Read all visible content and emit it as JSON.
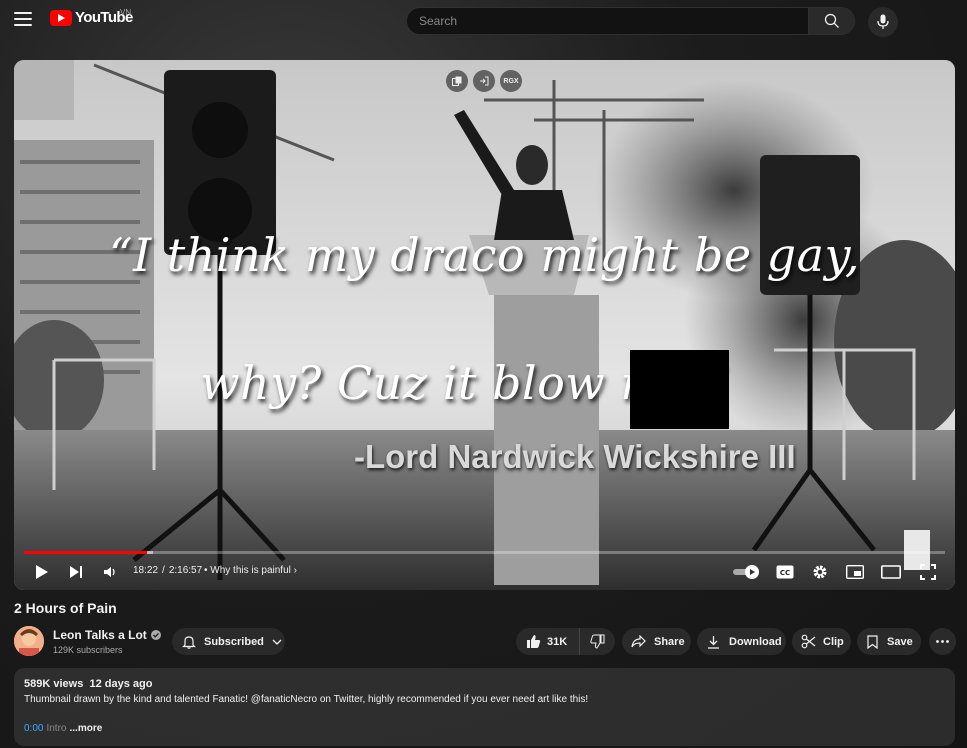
{
  "header": {
    "logo_text": "YouTube",
    "country_code": "VN",
    "search_placeholder": "Search"
  },
  "player": {
    "extension_badge": "RGX",
    "quote_line1": "“I think my draco might be gay,",
    "quote_line2": "why? Cuz it blow n     s.”",
    "attribution": "-Lord Nardwick Wickshire III",
    "current_time": "18:22",
    "time_separator": "/",
    "duration": "2:16:57",
    "chapter": "• Why this is painful",
    "progress_fraction": 0.134,
    "loaded_fraction": 0.14,
    "colors": {
      "progress_played": "#ff0000"
    }
  },
  "video": {
    "title": "2 Hours of Pain"
  },
  "channel": {
    "name": "Leon Talks a Lot",
    "verified_icon": "verified-check-icon",
    "subscribers": "129K subscribers",
    "subscribe_label": "Subscribed"
  },
  "actions": {
    "likes": "31K",
    "share": "Share",
    "download": "Download",
    "clip": "Clip",
    "save": "Save"
  },
  "description": {
    "views": "589K views",
    "age": "12 days ago",
    "text": "Thumbnail drawn by the kind and talented Fanatic! @fanaticNecro on Twitter, highly recommended if you ever need art like this!",
    "timestamp": "0:00",
    "intro": "Intro",
    "more": "...more"
  }
}
